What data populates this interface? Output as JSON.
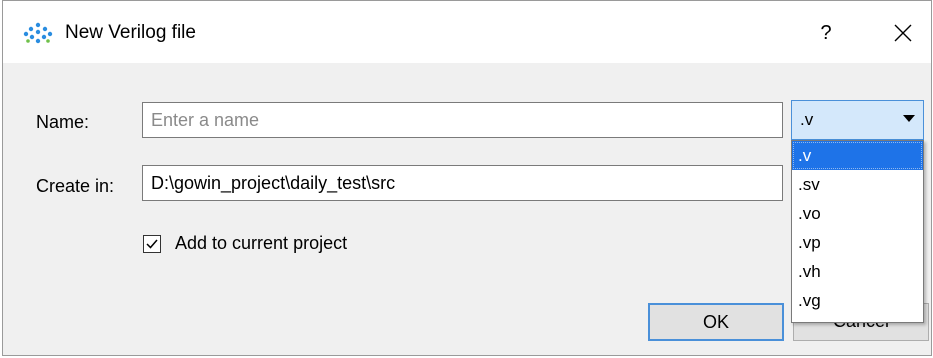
{
  "dialog": {
    "title": "New Verilog file",
    "help_glyph": "?",
    "close_glyph": "✕"
  },
  "form": {
    "name_label": "Name:",
    "name_placeholder": "Enter a name",
    "name_value": "",
    "create_in_label": "Create in:",
    "create_in_value": "D:\\gowin_project\\daily_test\\src",
    "extension_selected": ".v",
    "extension_options": [
      ".v",
      ".sv",
      ".vo",
      ".vp",
      ".vh",
      ".vg"
    ],
    "add_to_project_label": "Add to current project",
    "add_to_project_checked": true
  },
  "buttons": {
    "ok": "OK",
    "cancel": "Cancel"
  },
  "colors": {
    "selection": "#1e73e8",
    "combo_bg": "#d4e8fb",
    "focus_border": "#4a90d9"
  }
}
